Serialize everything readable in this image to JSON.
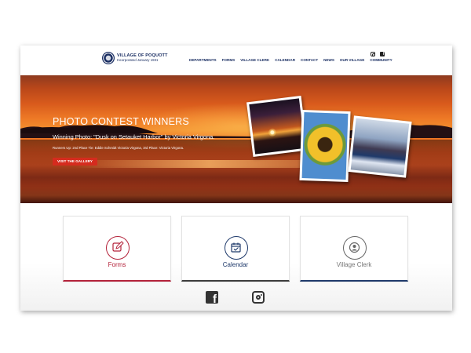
{
  "header": {
    "logo_title": "VILLAGE OF POQUOTT",
    "logo_subtitle": "Incorporated January 1931",
    "social_icons": [
      "instagram-icon",
      "facebook-icon"
    ]
  },
  "nav": {
    "items": [
      {
        "label": "DEPARTMENTS"
      },
      {
        "label": "FORMS"
      },
      {
        "label": "VILLAGE CLERK"
      },
      {
        "label": "CALENDAR"
      },
      {
        "label": "CONTACT"
      },
      {
        "label": "NEWS"
      },
      {
        "label": "OUR VILLAGE"
      },
      {
        "label": "COMMUNITY"
      }
    ]
  },
  "hero": {
    "title": "PHOTO CONTEST WINNERS",
    "subtitle": "Winning Photo: \"Dusk on Setauket Harbor\" by Victoria Virgona.",
    "runners_up": "Runners Up: 2nd Place Tie: Eddie Schmidt Victoria Virgona, 3rd Place: Victoria Virgona.",
    "button_label": "VISIT THE GALLERY"
  },
  "cards": [
    {
      "label": "Forms",
      "icon": "edit-form-icon",
      "color": "#b4233b"
    },
    {
      "label": "Calendar",
      "icon": "calendar-icon",
      "color": "#1f3a6b"
    },
    {
      "label": "Village Clerk",
      "icon": "person-icon",
      "color": "#777777"
    }
  ],
  "footer_social": {
    "icons": [
      "facebook-icon",
      "instagram-icon"
    ]
  },
  "colors": {
    "navy": "#1b2f63",
    "accent_red": "#d52b1e",
    "forms_red": "#b4233b"
  }
}
